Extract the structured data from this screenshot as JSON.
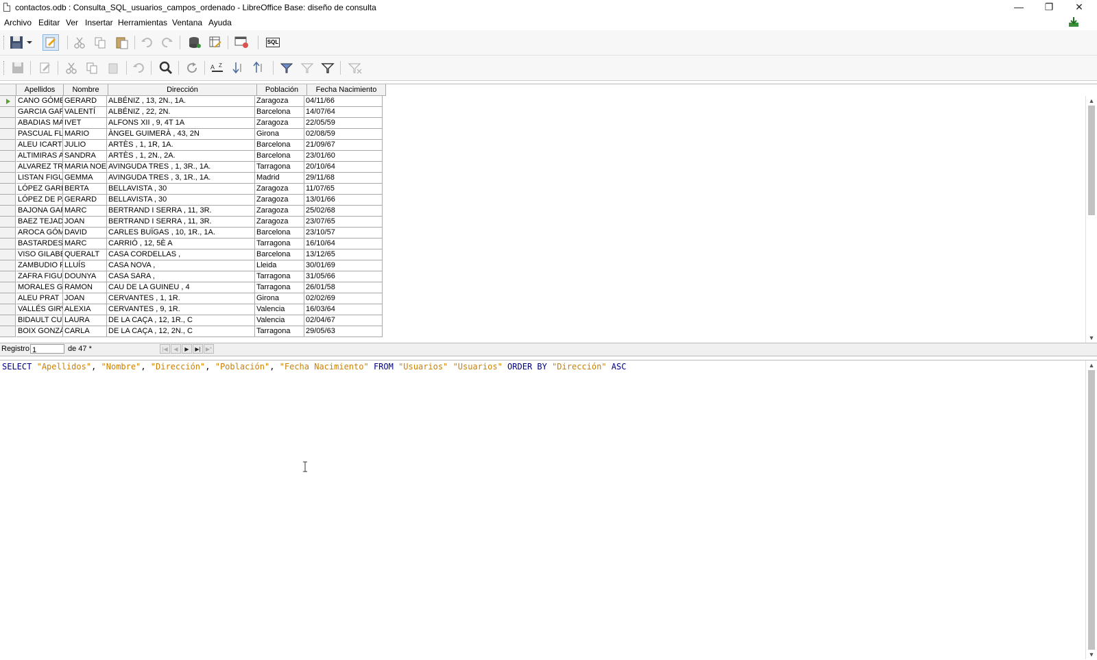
{
  "window": {
    "title": "contactos.odb : Consulta_SQL_usuarios_campos_ordenado - LibreOffice Base: diseño de consulta",
    "controls": {
      "minimize": "—",
      "restore": "❐",
      "close": "✕"
    }
  },
  "menu": [
    {
      "label": "Archivo",
      "name": "menu-archivo"
    },
    {
      "label": "Editar",
      "name": "menu-editar"
    },
    {
      "label": "Ver",
      "name": "menu-ver"
    },
    {
      "label": "Insertar",
      "name": "menu-insertar"
    },
    {
      "label": "Herramientas",
      "name": "menu-herramientas"
    },
    {
      "label": "Ventana",
      "name": "menu-ventana"
    },
    {
      "label": "Ayuda",
      "name": "menu-ayuda"
    }
  ],
  "toolbar1": {
    "icons": [
      "save-icon",
      "dropdown-arrow-icon",
      "edit-mode-icon",
      "cut-icon",
      "copy-icon",
      "paste-icon",
      "undo-icon",
      "redo-icon",
      "run-query-icon",
      "clear-query-icon",
      "switch-design-view-icon",
      "run-sql-direct-icon"
    ],
    "sql_button_label": "SQL"
  },
  "toolbar2": {
    "icons": [
      "save-record-icon",
      "edit-data-icon",
      "cut-icon",
      "copy-icon",
      "paste-icon",
      "undo-icon",
      "find-record-icon",
      "refresh-icon",
      "sort-icon",
      "sort-ascending-icon",
      "sort-descending-icon",
      "autofilter-icon",
      "apply-filter-icon",
      "standard-filter-icon",
      "reset-filter-icon"
    ]
  },
  "grid": {
    "columns": [
      "Apellidos",
      "Nombre",
      "Dirección",
      "Población",
      "Fecha Nacimiento"
    ],
    "rows": [
      [
        "CANO GÓMEZ",
        "GERARD",
        "ALBÉNIZ , 13, 2N., 1A.",
        "Zaragoza",
        "04/11/66"
      ],
      [
        "GARCIA GARCIA",
        "VALENTÍ",
        "ALBÉNIZ , 22, 2N.",
        "Barcelona",
        "14/07/64"
      ],
      [
        "ABADIAS MARTÍ",
        "IVET",
        "ALFONS XII , 9, 4T 1A",
        "Zaragoza",
        "22/05/59"
      ],
      [
        "PASCUAL FLORES",
        "MARIO",
        "ÀNGEL GUIMERÀ , 43, 2N",
        "Girona",
        "02/08/59"
      ],
      [
        "ALEU ICART",
        "JULIO",
        "ARTÈS , 1, 1R, 1A.",
        "Barcelona",
        "21/09/67"
      ],
      [
        "ALTIMIRAS ARMENGOL",
        "SANDRA",
        "ARTÈS , 1, 2N., 2A.",
        "Barcelona",
        "23/01/60"
      ],
      [
        "ALVAREZ TRONCOSO",
        "MARIA NOELIA",
        "AVINGUDA TRES , 1, 3R., 1A.",
        "Tarragona",
        "20/10/64"
      ],
      [
        "LISTAN FIGUERAS",
        "GEMMA",
        "AVINGUDA TRES , 3, 1R., 1A.",
        "Madrid",
        "29/11/68"
      ],
      [
        "LÓPEZ GARRIDO",
        "BERTA",
        "BELLAVISTA , 30",
        "Zaragoza",
        "11/07/65"
      ],
      [
        "LÓPEZ DE PABLO",
        "GERARD",
        "BELLAVISTA , 30",
        "Zaragoza",
        "13/01/66"
      ],
      [
        "BAJONA GARCIA",
        "MARC",
        "BERTRAND I SERRA , 11, 3R.",
        "Zaragoza",
        "25/02/68"
      ],
      [
        "BAEZ TEJADO",
        "JOAN",
        "BERTRAND I SERRA , 11, 3R.",
        "Zaragoza",
        "23/07/65"
      ],
      [
        "AROCA GÓMEZ",
        "DAVID",
        "CARLES BUÏGAS , 10, 1R., 1A.",
        "Barcelona",
        "23/10/57"
      ],
      [
        "BASTARDES SOLER",
        "MARC",
        "CARRIÓ , 12, 5È A",
        "Tarragona",
        "16/10/64"
      ],
      [
        "VISO GILABERT",
        "QUERALT",
        "CASA CORDELLAS ,",
        "Barcelona",
        "13/12/65"
      ],
      [
        "ZAMBUDIO FERRER",
        "LLUÍS",
        "CASA NOVA ,",
        "Lleida",
        "30/01/69"
      ],
      [
        "ZAFRA FIGUERAS",
        "DOUNYA",
        "CASA SARA ,",
        "Tarragona",
        "31/05/66"
      ],
      [
        "MORALES GIL",
        "RAMON",
        "CAU DE LA GUINEU , 4",
        "Tarragona",
        "26/01/58"
      ],
      [
        "ALEU PRAT",
        "JOAN",
        "CERVANTES , 1, 1R.",
        "Girona",
        "02/02/69"
      ],
      [
        "VALLÉS GIRVENT",
        "ALEXIA",
        "CERVANTES , 9, 1R.",
        "Valencia",
        "16/03/64"
      ],
      [
        "BIDAULT CUEVAS",
        "LAURA",
        "DE LA CAÇA , 12, 1R., C",
        "Valencia",
        "02/04/67"
      ],
      [
        "BOIX GONZÁLEZ",
        "CARLA",
        "DE LA CAÇA , 12, 2N., C",
        "Tarragona",
        "29/05/63"
      ]
    ]
  },
  "navigator": {
    "label": "Registro",
    "value": "1",
    "of_text": "de 47 *"
  },
  "sql": {
    "tokens": [
      {
        "t": "SELECT",
        "c": "kw"
      },
      {
        "t": " ",
        "c": "pun"
      },
      {
        "t": "\"Apellidos\"",
        "c": "str"
      },
      {
        "t": ", ",
        "c": "pun"
      },
      {
        "t": "\"Nombre\"",
        "c": "str"
      },
      {
        "t": ", ",
        "c": "pun"
      },
      {
        "t": "\"Dirección\"",
        "c": "str"
      },
      {
        "t": ", ",
        "c": "pun"
      },
      {
        "t": "\"Población\"",
        "c": "str"
      },
      {
        "t": ", ",
        "c": "pun"
      },
      {
        "t": "\"Fecha Nacimiento\"",
        "c": "str"
      },
      {
        "t": " ",
        "c": "pun"
      },
      {
        "t": "FROM",
        "c": "kw"
      },
      {
        "t": " ",
        "c": "pun"
      },
      {
        "t": "\"Usuarios\"",
        "c": "str"
      },
      {
        "t": " ",
        "c": "pun"
      },
      {
        "t": "\"Usuarios\"",
        "c": "str"
      },
      {
        "t": " ",
        "c": "pun"
      },
      {
        "t": "ORDER BY",
        "c": "kw"
      },
      {
        "t": " ",
        "c": "pun"
      },
      {
        "t": "\"Dirección\"",
        "c": "str"
      },
      {
        "t": " ",
        "c": "pun"
      },
      {
        "t": "ASC",
        "c": "kw"
      }
    ]
  },
  "colors": {
    "sql_keyword": "#000080",
    "sql_string": "#cc8000",
    "current_row_marker": "#5aa02c",
    "toolbar_bg": "#f7f7f7"
  }
}
